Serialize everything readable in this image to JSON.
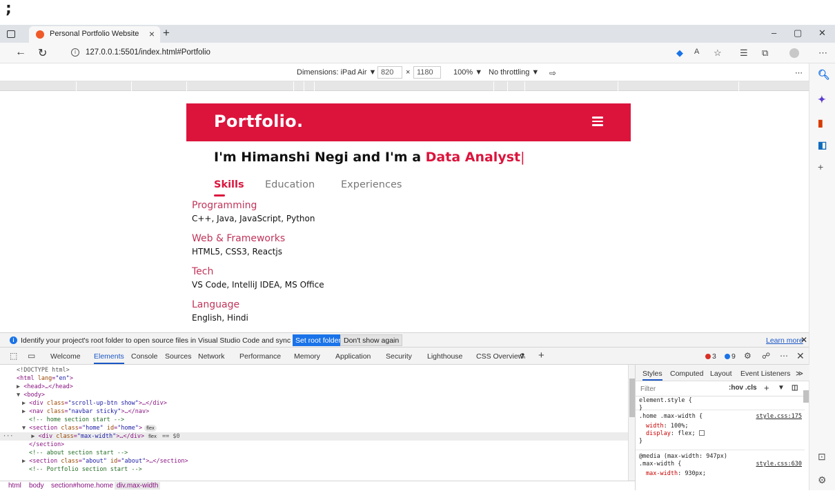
{
  "top": {
    "glyph": ";"
  },
  "browser": {
    "tab_title": "Personal Portfolio Website",
    "tab_close": "×",
    "new_tab": "+",
    "win_min": "–",
    "win_restore": "▢",
    "win_close": "✕",
    "url": "127.0.0.1:5501/index.html#Portfolio",
    "url_info": "i"
  },
  "device_toolbar": {
    "dimensions_label": "Dimensions: iPad Air ▼",
    "width": "820",
    "times": "×",
    "height": "1180",
    "zoom": "100% ▼",
    "throttling": "No throttling ▼",
    "more": "⋯"
  },
  "portfolio": {
    "logo": "Portfolio.",
    "headline_prefix": "I'm Himanshi Negi and I'm a ",
    "headline_accent": "Data Analyst",
    "headline_cursor": "|",
    "tabs": [
      "Skills",
      "Education",
      "Experiences"
    ],
    "skills": [
      {
        "heading": "Programming",
        "value": "C++, Java, JavaScript, Python"
      },
      {
        "heading": "Web & Frameworks",
        "value": "HTML5, CSS3, Reactjs"
      },
      {
        "heading": "Tech",
        "value": "VS Code, IntelliJ IDEA, MS Office"
      },
      {
        "heading": "Language",
        "value": "English, Hindi"
      }
    ]
  },
  "infobar": {
    "message": "Identify your project's root folder to open source files in Visual Studio Code and sync changes.",
    "primary_button": "Set root folder",
    "secondary_button": "Don't show again",
    "learn_more": "Learn more",
    "close": "✕"
  },
  "devtools": {
    "tabs": [
      "Welcome",
      "Elements",
      "Console",
      "Sources",
      "Network",
      "Performance",
      "Memory",
      "Application",
      "Security",
      "Lighthouse",
      "CSS Overview"
    ],
    "error_count": "3",
    "info_count": "9",
    "close": "✕",
    "more": "⋯",
    "add": "+",
    "flask": "⚗",
    "dom": {
      "doctype": "<!DOCTYPE html>",
      "html_open": "<html ",
      "html_attr": "lang",
      "html_val": "\"en\"",
      "head": "<head>…</head>",
      "body": "<body>",
      "div1_open": "<div ",
      "div1_val": "\"scroll-up-btn show\"",
      "div1_close": ">…</div>",
      "nav_open": "<nav ",
      "nav_val": "\"navbar sticky\"",
      "nav_close": ">…</nav>",
      "cmt_home": "<!-- home section start -->",
      "section_open": "<section ",
      "section_class_val": "\"home\"",
      "section_id_val": "\"home\"",
      "section_gt": ">",
      "flex": "flex",
      "div2_val": "\"max-width\"",
      "div2_close": ">…</div>",
      "eq0": "== $0",
      "section_end": "</section>",
      "cmt_about": "<!-- about section start -->",
      "about_class_val": "\"about\"",
      "about_id_val": "\"about\"",
      "about_close": ">…</section>",
      "cmt_portfolio": "<!-- Portfolio section start -->",
      "attr_class": "class",
      "attr_id": "id",
      "eq": "=",
      "dots": "···"
    },
    "styles_tabs": [
      "Styles",
      "Computed",
      "Layout",
      "Event Listeners"
    ],
    "styles_more": "≫",
    "filter_placeholder": "Filter",
    "filter_tools": ":hov  .cls",
    "css": {
      "element_style": "element.style {",
      "close_brace": "}",
      "rule2_selector": ".home .max-width {",
      "rule2_src": "style.css:175",
      "rule2_p1_name": "width",
      "rule2_p1_val": "100%;",
      "rule2_p2_name": "display",
      "rule2_p2_val": "flex;",
      "media": "@media (max-width: 947px)",
      "rule3_selector": ".max-width {",
      "rule3_src": "style.css:630",
      "rule3_p1_name": "max-width",
      "rule3_p1_val": "930px;"
    }
  },
  "breadcrumbs": [
    "html",
    "body",
    "section#home.home",
    "div.max-width"
  ],
  "colors": {
    "accent": "#dc143c",
    "devtools_blue": "#1a56c4"
  }
}
